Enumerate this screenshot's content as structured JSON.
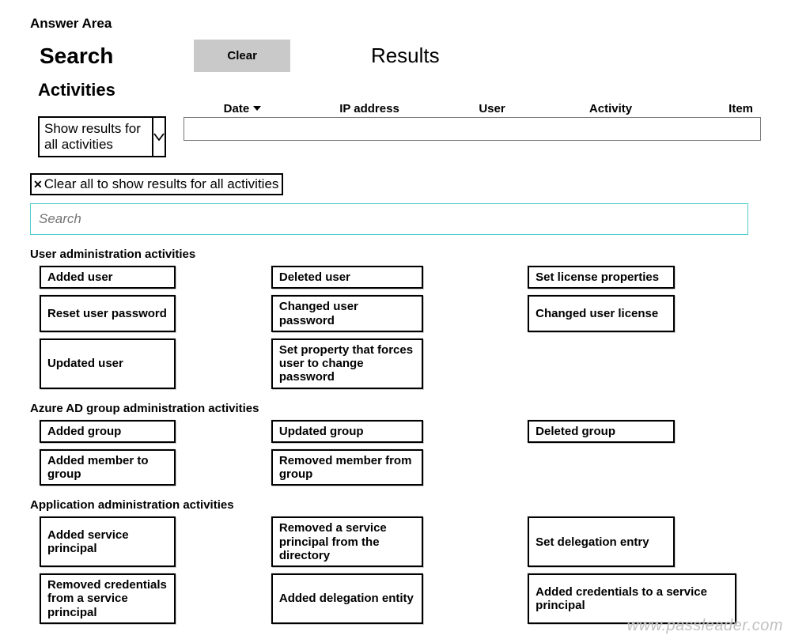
{
  "header": {
    "answer_area": "Answer Area",
    "search": "Search",
    "clear": "Clear",
    "results": "Results",
    "activities": "Activities"
  },
  "dropdown": {
    "label": "Show results for all activities"
  },
  "columns": {
    "date": "Date",
    "ip": "IP address",
    "user": "User",
    "activity": "Activity",
    "item": "Item"
  },
  "clear_all": "Clear all to show results for all activities",
  "search_placeholder": "Search",
  "sections": {
    "user_admin": {
      "title": "User administration activities",
      "rows": [
        [
          "Added user",
          "Deleted user",
          "Set license properties"
        ],
        [
          "Reset user password",
          "Changed user password",
          "Changed user license"
        ],
        [
          "Updated user",
          "Set property that forces user to change password",
          ""
        ]
      ]
    },
    "group_admin": {
      "title": "Azure AD group administration activities",
      "rows": [
        [
          "Added group",
          "Updated group",
          "Deleted group"
        ],
        [
          "Added member to group",
          "Removed member from group",
          ""
        ]
      ]
    },
    "app_admin": {
      "title": "Application administration activities",
      "rows": [
        [
          "Added service principal",
          "Removed a service principal from the directory",
          "Set delegation entry"
        ],
        [
          "Removed credentials from a service principal",
          "Added delegation entity",
          "Added credentials to a service principal"
        ]
      ]
    }
  },
  "watermark": "www.passleader.com"
}
